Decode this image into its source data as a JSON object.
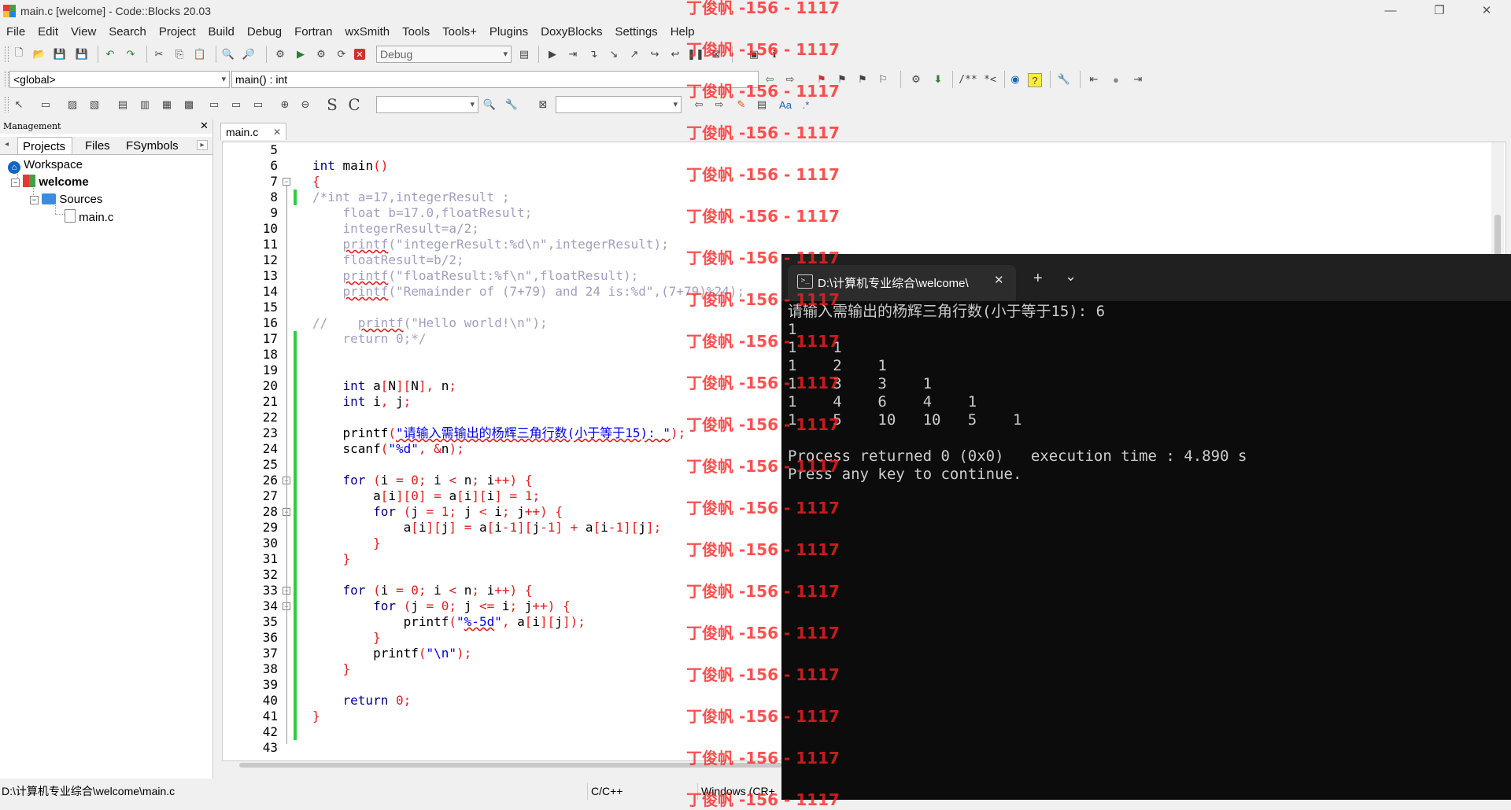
{
  "window": {
    "title": "main.c [welcome] - Code::Blocks 20.03",
    "min": "—",
    "max": "❐",
    "close": "✕"
  },
  "menu": [
    "File",
    "Edit",
    "View",
    "Search",
    "Project",
    "Build",
    "Debug",
    "Fortran",
    "wxSmith",
    "Tools",
    "Tools+",
    "Plugins",
    "DoxyBlocks",
    "Settings",
    "Help"
  ],
  "toolbar": {
    "build_target": "Debug",
    "scope": "<global>",
    "symbol": "main() : int",
    "doxy_comment": "/**",
    "doxy_inline": "*<",
    "search_regex": ".*",
    "search_aa": "Aa"
  },
  "management": {
    "title": "Management",
    "tabs": [
      "Projects",
      "Files",
      "FSymbols"
    ],
    "tree": {
      "workspace": "Workspace",
      "project": "welcome",
      "folder": "Sources",
      "file": "main.c"
    }
  },
  "editor": {
    "tab": "main.c",
    "lines": [
      {
        "n": "5",
        "t": ""
      },
      {
        "n": "6",
        "t": "<span class='kw'>int</span> main<span class='op'>()</span>"
      },
      {
        "n": "7",
        "t": "<span class='op'>{</span>"
      },
      {
        "n": "8",
        "t": "<span class='cm'>/*int a=17,integerResult ;</span>"
      },
      {
        "n": "9",
        "t": "<span class='cm'>    float b=17.0,floatResult;</span>"
      },
      {
        "n": "10",
        "t": "<span class='cm'>    integerResult=a/2;</span>"
      },
      {
        "n": "11",
        "t": "<span class='cm'>    <span class='sq'>printf</span>(\"integerResult:%d\\n\",integerResult);</span>"
      },
      {
        "n": "12",
        "t": "<span class='cm'>    floatResult=b/2;</span>"
      },
      {
        "n": "13",
        "t": "<span class='cm'>    <span class='sq'>printf</span>(\"floatResult:%f\\n\",floatResult);</span>"
      },
      {
        "n": "14",
        "t": "<span class='cm'>    <span class='sq'>printf</span>(\"Remainder of (7+79) and 24 is:%d\",(7+79)%24);</span>"
      },
      {
        "n": "15",
        "t": ""
      },
      {
        "n": "16",
        "t": "<span class='cm'>//    <span class='sq'>printf</span>(\"Hello world!\\n\");</span>"
      },
      {
        "n": "17",
        "t": "<span class='cm'>    return 0;*/</span>"
      },
      {
        "n": "18",
        "t": ""
      },
      {
        "n": "19",
        "t": ""
      },
      {
        "n": "20",
        "t": "    <span class='kw'>int</span> a<span class='op'>[</span>N<span class='op'>][</span>N<span class='op'>],</span> n<span class='op'>;</span>"
      },
      {
        "n": "21",
        "t": "    <span class='kw'>int</span> i<span class='op'>,</span> j<span class='op'>;</span>"
      },
      {
        "n": "22",
        "t": ""
      },
      {
        "n": "23",
        "t": "    printf<span class='op'>(</span><span class='str sq'>\"请输入需输出的杨辉三角行数(小于等于15): \"</span><span class='op'>);</span>"
      },
      {
        "n": "24",
        "t": "    scanf<span class='op'>(</span><span class='str'>\"%d\"</span><span class='op'>,</span> <span class='op'>&amp;</span>n<span class='op'>);</span>"
      },
      {
        "n": "25",
        "t": ""
      },
      {
        "n": "26",
        "t": "    <span class='kw'>for</span> <span class='op'>(</span>i <span class='op'>=</span> <span class='num'>0</span><span class='op'>;</span> i <span class='op'>&lt;</span> n<span class='op'>;</span> i<span class='op'>++)</span> <span class='op'>{</span>"
      },
      {
        "n": "27",
        "t": "        a<span class='op'>[</span>i<span class='op'>][</span><span class='num'>0</span><span class='op'>]</span> <span class='op'>=</span> a<span class='op'>[</span>i<span class='op'>][</span>i<span class='op'>]</span> <span class='op'>=</span> <span class='num'>1</span><span class='op'>;</span>"
      },
      {
        "n": "28",
        "t": "        <span class='kw'>for</span> <span class='op'>(</span>j <span class='op'>=</span> <span class='num'>1</span><span class='op'>;</span> j <span class='op'>&lt;</span> i<span class='op'>;</span> j<span class='op'>++)</span> <span class='op'>{</span>"
      },
      {
        "n": "29",
        "t": "            a<span class='op'>[</span>i<span class='op'>][</span>j<span class='op'>]</span> <span class='op'>=</span> a<span class='op'>[</span>i<span class='op'>-</span><span class='num'>1</span><span class='op'>][</span>j<span class='op'>-</span><span class='num'>1</span><span class='op'>]</span> <span class='op'>+</span> a<span class='op'>[</span>i<span class='op'>-</span><span class='num'>1</span><span class='op'>][</span>j<span class='op'>];</span>"
      },
      {
        "n": "30",
        "t": "        <span class='op'>}</span>"
      },
      {
        "n": "31",
        "t": "    <span class='op'>}</span>"
      },
      {
        "n": "32",
        "t": ""
      },
      {
        "n": "33",
        "t": "    <span class='kw'>for</span> <span class='op'>(</span>i <span class='op'>=</span> <span class='num'>0</span><span class='op'>;</span> i <span class='op'>&lt;</span> n<span class='op'>;</span> i<span class='op'>++)</span> <span class='op'>{</span>"
      },
      {
        "n": "34",
        "t": "        <span class='kw'>for</span> <span class='op'>(</span>j <span class='op'>=</span> <span class='num'>0</span><span class='op'>;</span> j <span class='op'>&lt;=</span> i<span class='op'>;</span> j<span class='op'>++)</span> <span class='op'>{</span>"
      },
      {
        "n": "35",
        "t": "            printf<span class='op'>(</span><span class='str'>\"<span class='sq'>%-5d</span>\"</span><span class='op'>,</span> a<span class='op'>[</span>i<span class='op'>][</span>j<span class='op'>]);</span>"
      },
      {
        "n": "36",
        "t": "        <span class='op'>}</span>"
      },
      {
        "n": "37",
        "t": "        printf<span class='op'>(</span><span class='str'>\"\\n\"</span><span class='op'>);</span>"
      },
      {
        "n": "38",
        "t": "    <span class='op'>}</span>"
      },
      {
        "n": "39",
        "t": ""
      },
      {
        "n": "40",
        "t": "    <span class='kw'>return</span> <span class='num'>0</span><span class='op'>;</span>"
      },
      {
        "n": "41",
        "t": "<span class='op'>}</span>"
      },
      {
        "n": "42",
        "t": ""
      },
      {
        "n": "43",
        "t": ""
      }
    ]
  },
  "terminal": {
    "tab_title": "D:\\计算机专业综合\\welcome\\",
    "new_tab": "+",
    "dropdown": "⌄",
    "lines": [
      "请输入需输出的杨辉三角行数(小于等于15): 6",
      "1",
      "1    1",
      "1    2    1",
      "1    3    3    1",
      "1    4    6    4    1",
      "1    5    10   10   5    1",
      "",
      "Process returned 0 (0x0)   execution time : 4.890 s",
      "Press any key to continue."
    ]
  },
  "status": {
    "path": "D:\\计算机专业综合\\welcome\\main.c",
    "lang": "C/C++",
    "eol": "Windows (CR+"
  },
  "watermark": "丁俊帆 -156 - 1117"
}
